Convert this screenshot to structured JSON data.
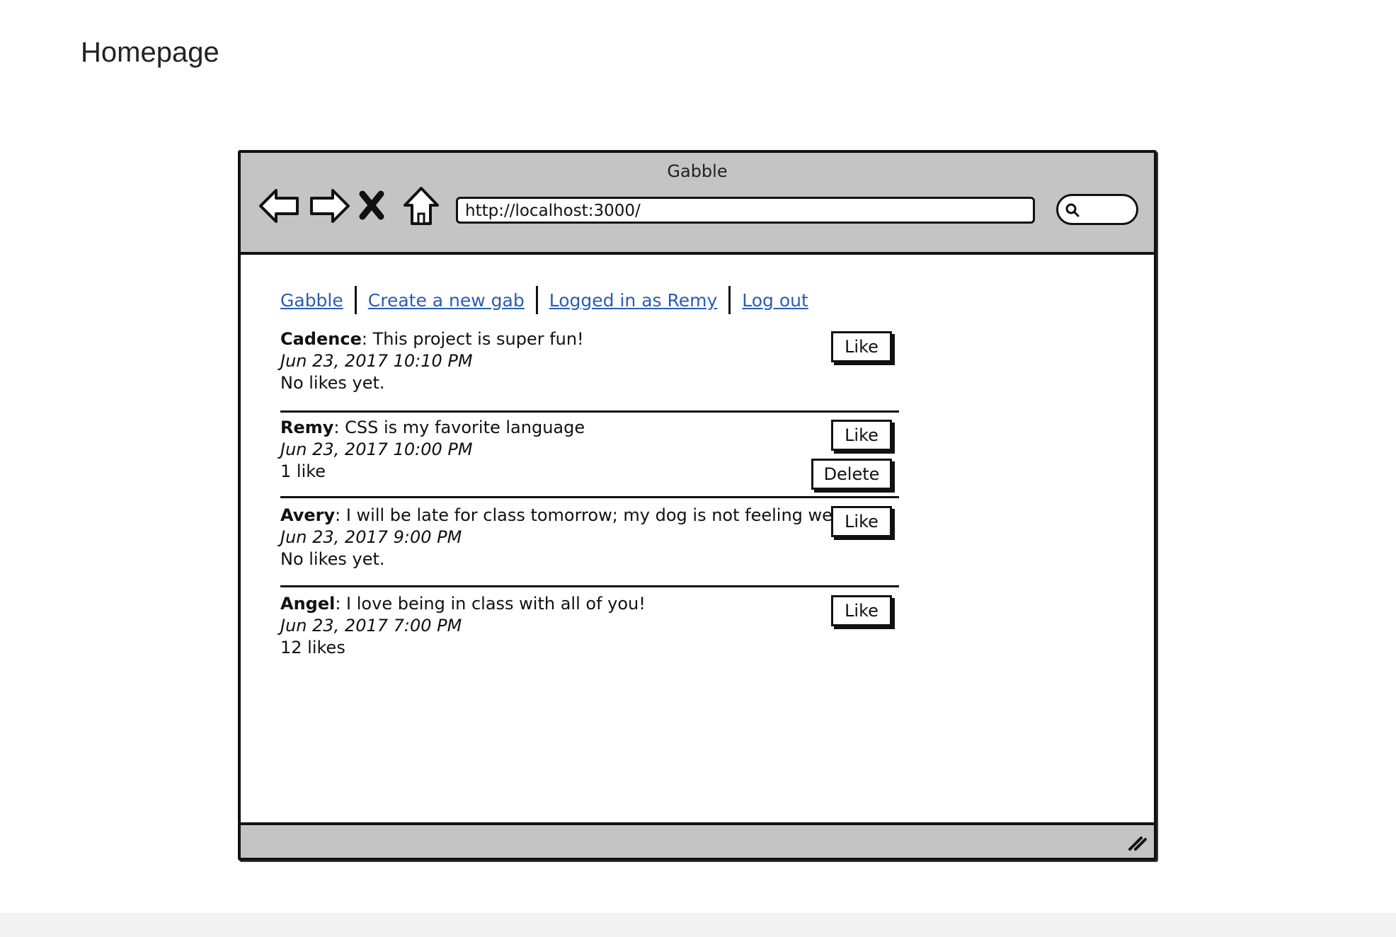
{
  "page": {
    "heading": "Homepage"
  },
  "browser": {
    "window_title": "Gabble",
    "url": "http://localhost:3000/",
    "icons": {
      "back": "back-arrow-icon",
      "forward": "forward-arrow-icon",
      "stop": "stop-x-icon",
      "home": "home-icon",
      "search": "search-icon",
      "resize": "resize-grip-icon"
    }
  },
  "nav": {
    "links": [
      "Gabble",
      "Create a new gab",
      "Logged in as Remy",
      "Log out"
    ],
    "link_color": "#2a5db0"
  },
  "posts": [
    {
      "author": "Cadence",
      "text": ": This project is super fun!",
      "time": "Jun 23, 2017 10:10 PM",
      "likes": "No likes yet.",
      "like_label": "Like"
    },
    {
      "author": "Remy",
      "text": ": CSS is my favorite language",
      "time": "Jun 23, 2017 10:00 PM",
      "likes": "1 like",
      "like_label": "Like",
      "delete_label": "Delete"
    },
    {
      "author": "Avery",
      "text": ": I will be late for class tomorrow; my dog is not feeling well.",
      "time": "Jun 23, 2017 9:00 PM",
      "likes": "No likes yet.",
      "like_label": "Like"
    },
    {
      "author": "Angel",
      "text": ": I love being in class with all of you!",
      "time": "Jun 23, 2017 7:00 PM",
      "likes": "12 likes",
      "like_label": "Like"
    }
  ],
  "colors": {
    "chrome": "#c4c4c4",
    "border": "#111111"
  }
}
